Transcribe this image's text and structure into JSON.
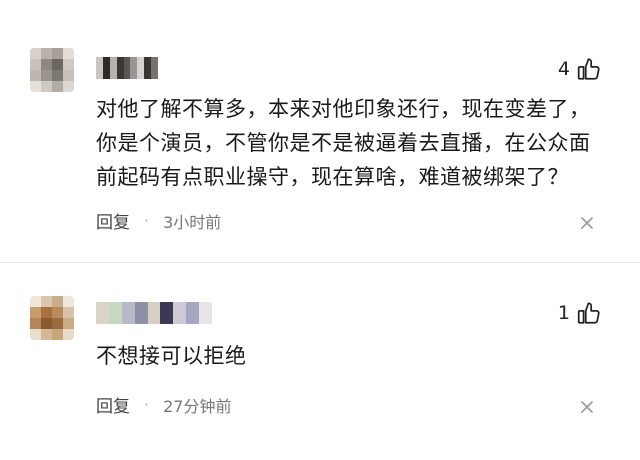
{
  "comments": [
    {
      "username": "",
      "likes": "4",
      "text": "对他了解不算多，本来对他印象还行，现在变差了，\n你是个演员，不管你是不是被逼着去直播，在公众面\n前起码有点职业操守，现在算啥，难道被绑架了？",
      "reply_label": "回复",
      "separator": "·",
      "time": "3小时前",
      "avatar_colors": [
        "#d8d2cc",
        "#b9b2ad",
        "#a7a09a",
        "#e2ddd8",
        "#c8c2bd",
        "#8e8782",
        "#6c6661",
        "#d0cac5",
        "#bdb6b1",
        "#9a938e",
        "#7d7772",
        "#c6c0bb",
        "#e4e0dc",
        "#cfc9c4",
        "#b2aca7",
        "#dcd7d2"
      ],
      "name_colors": [
        "#c9c4c0",
        "#2d2a27",
        "#b7b2ae",
        "#3b3835",
        "#5a5653",
        "#9a9592",
        "#d6d2cf",
        "#3a3733",
        "#767270"
      ]
    },
    {
      "username": "",
      "likes": "1",
      "text": "不想接可以拒绝",
      "reply_label": "回复",
      "separator": "·",
      "time": "27分钟前",
      "avatar_colors": [
        "#efe7dc",
        "#d9c6ad",
        "#c9ac88",
        "#eee6da",
        "#c79d6e",
        "#a86f3f",
        "#b98a5c",
        "#d8c3a6",
        "#b68458",
        "#8c5a2f",
        "#9b6a3f",
        "#c9ab86",
        "#e9dfd0",
        "#d3b893",
        "#c7a57e",
        "#e7dccb"
      ],
      "name_colors": [
        "#d9d4c8",
        "#c6d8c0",
        "#b7b9c6",
        "#8e90a8",
        "#d7cfc4",
        "#3a3a55",
        "#cfc9d6",
        "#a7a5c2",
        "#e8e4ea"
      ]
    }
  ],
  "icons": {
    "like": "thumbs-up-icon",
    "close": "close-icon"
  }
}
